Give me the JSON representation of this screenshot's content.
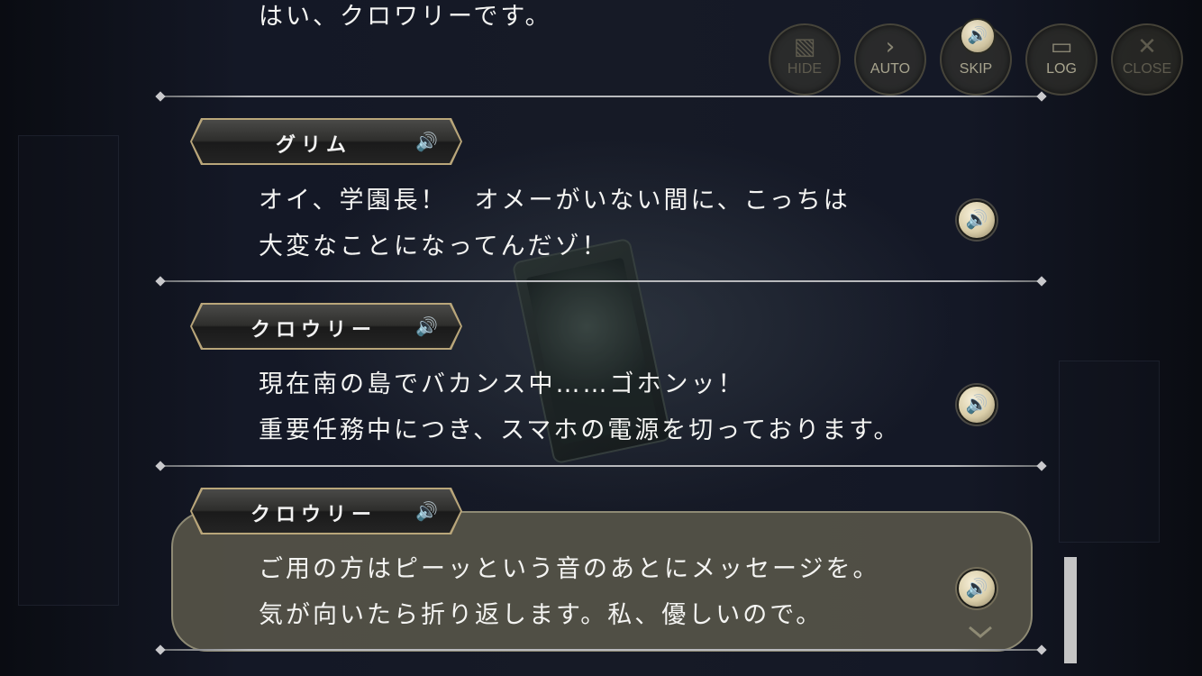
{
  "controls": [
    {
      "id": "hide",
      "label": "HIDE",
      "icon": "hide-icon"
    },
    {
      "id": "auto",
      "label": "AUTO",
      "icon": "play-arrow-icon"
    },
    {
      "id": "skip",
      "label": "SKIP",
      "icon": "speaker-icon"
    },
    {
      "id": "log",
      "label": "LOG",
      "icon": "chat-bubble-icon"
    },
    {
      "id": "close",
      "label": "CLOSE",
      "icon": "close-icon"
    }
  ],
  "log": {
    "entry0": {
      "line1": "はい、クロワリーです。"
    },
    "entry1": {
      "speaker": "グリム",
      "line1": "オイ、学園長！　オメーがいない間に、こっちは",
      "line2": "大変なことになってんだゾ！"
    },
    "entry2": {
      "speaker": "クロウリー",
      "line1": "現在南の島でバカンス中……ゴホンッ！",
      "line2": "重要任務中につき、スマホの電源を切っております。"
    },
    "entry3": {
      "speaker": "クロウリー",
      "line1": "ご用の方はピーッという音のあとにメッセージを。",
      "line2": "気が向いたら折り返します。私、優しいので。"
    }
  },
  "colors": {
    "nameplate_border": "#b9a67a",
    "bubble": "#56544a",
    "text": "#f4f4f2"
  }
}
